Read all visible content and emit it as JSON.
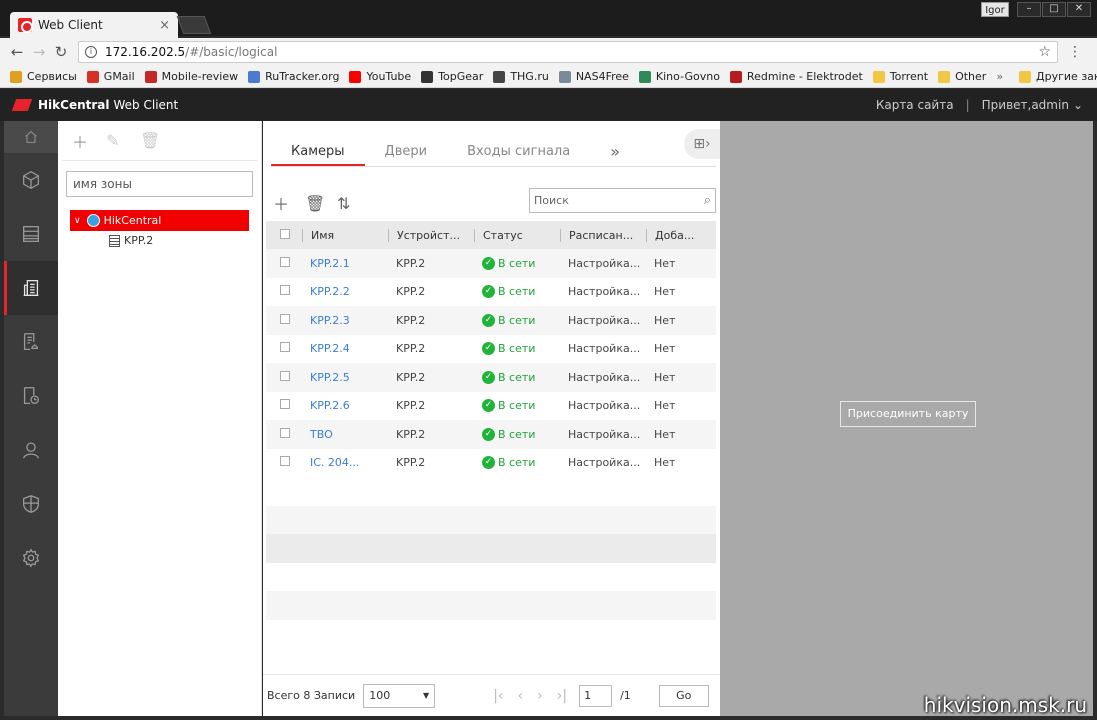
{
  "browser": {
    "tab_title": "Web Client",
    "tab_close": "×",
    "window_user": "Igor",
    "window_buttons": [
      "–",
      "□",
      "✕"
    ],
    "url_host": "172.16.202.5",
    "url_path": "/#/basic/logical",
    "bookmarks": [
      {
        "label": "Сервисы",
        "color": "#e0a020"
      },
      {
        "label": "GMail",
        "color": "#d93025"
      },
      {
        "label": "Mobile-review",
        "color": "#c62828"
      },
      {
        "label": "RuTracker.org",
        "color": "#4a7bd0"
      },
      {
        "label": "YouTube",
        "color": "#ff0000"
      },
      {
        "label": "TopGear",
        "color": "#333333"
      },
      {
        "label": "THG.ru",
        "color": "#444444"
      },
      {
        "label": "NAS4Free",
        "color": "#7a8a9a"
      },
      {
        "label": "Kino-Govno",
        "color": "#2e8b57"
      },
      {
        "label": "Redmine - Elektrodet",
        "color": "#b71c1c"
      },
      {
        "label": "Torrent",
        "color": "#f2c744"
      },
      {
        "label": "Other",
        "color": "#f2c744"
      }
    ],
    "bookmarks_more": "»",
    "other_bookmarks": "Другие закладки",
    "other_bookmarks_color": "#f2c744"
  },
  "app": {
    "brand_bold": "HikCentral",
    "brand_rest": "Web Client",
    "sitemap": "Карта сайта",
    "separator": "|",
    "greeting": "Привет,admin",
    "accent": "#e5252a"
  },
  "tree": {
    "zone_placeholder": "имя зоны",
    "root_label": "HikCentral",
    "child_label": "KPP.2"
  },
  "list": {
    "tabs": [
      "Камеры",
      "Двери",
      "Входы сигнала"
    ],
    "tabs_more": "»",
    "search_placeholder": "Поиск",
    "columns": [
      "Имя",
      "Устройст...",
      "Статус",
      "Расписан...",
      "Доба..."
    ],
    "rows": [
      {
        "name": "KPP.2.1",
        "device": "KPP.2",
        "status": "В сети",
        "schedule": "Настройка...",
        "added": "Нет"
      },
      {
        "name": "KPP.2.2",
        "device": "KPP.2",
        "status": "В сети",
        "schedule": "Настройка...",
        "added": "Нет"
      },
      {
        "name": "KPP.2.3",
        "device": "KPP.2",
        "status": "В сети",
        "schedule": "Настройка...",
        "added": "Нет"
      },
      {
        "name": "KPP.2.4",
        "device": "KPP.2",
        "status": "В сети",
        "schedule": "Настройка...",
        "added": "Нет"
      },
      {
        "name": "KPP.2.5",
        "device": "KPP.2",
        "status": "В сети",
        "schedule": "Настройка...",
        "added": "Нет"
      },
      {
        "name": "KPP.2.6",
        "device": "KPP.2",
        "status": "В сети",
        "schedule": "Настройка...",
        "added": "Нет"
      },
      {
        "name": "TBO",
        "device": "KPP.2",
        "status": "В сети",
        "schedule": "Настройка...",
        "added": "Нет"
      },
      {
        "name": "IC. 204...",
        "device": "KPP.2",
        "status": "В сети",
        "schedule": "Настройка...",
        "added": "Нет"
      }
    ],
    "status_color": "#22a23a",
    "link_color": "#3a7fd0"
  },
  "pager": {
    "total_label": "Всего 8 Записи",
    "page_size": "100",
    "current_page": "1",
    "total_pages": "/1",
    "go_label": "Go"
  },
  "map": {
    "attach_label": "Присоединить карту"
  },
  "watermark": "hikvision.msk.ru"
}
